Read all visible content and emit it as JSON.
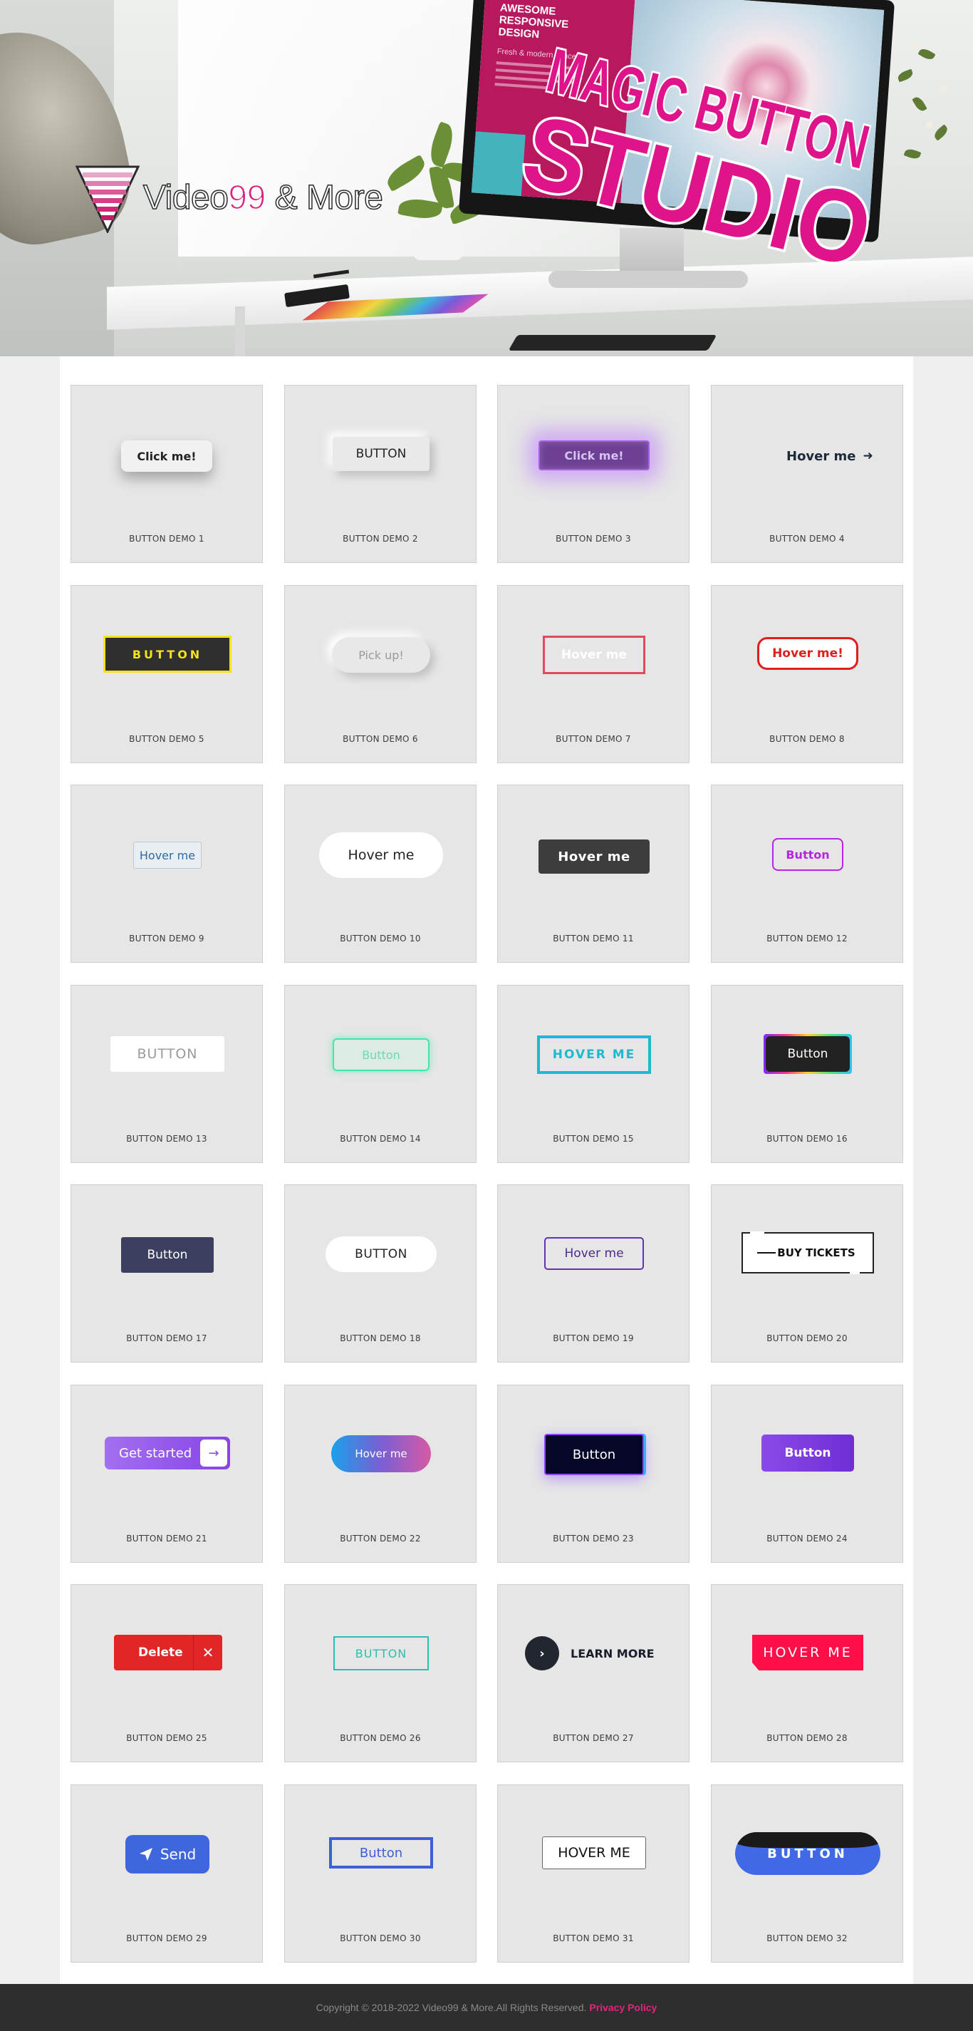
{
  "hero": {
    "logo_text_a": "Video",
    "logo_text_b": "99",
    "logo_text_c": " & More",
    "title_line1": "MAGIC BUTTON",
    "title_line2": "STUDIO",
    "screen_heading": "AWESOME RESPONSIVE DESIGN",
    "screen_sub": "Fresh & modern concept",
    "colors": {
      "brand_pink": "#d9237f"
    }
  },
  "demos": [
    {
      "button": "Click me!",
      "label": "BUTTON DEMO 1"
    },
    {
      "button": "BUTTON",
      "label": "BUTTON DEMO 2"
    },
    {
      "button": "Click me!",
      "label": "BUTTON DEMO 3"
    },
    {
      "button": "Hover me",
      "label": "BUTTON DEMO 4"
    },
    {
      "button": "BUTTON",
      "label": "BUTTON DEMO 5"
    },
    {
      "button": "Pick up!",
      "label": "BUTTON DEMO 6"
    },
    {
      "button": "Hover me",
      "label": "BUTTON DEMO 7"
    },
    {
      "button": "Hover me!",
      "label": "BUTTON DEMO 8"
    },
    {
      "button": "Hover me",
      "label": "BUTTON DEMO 9"
    },
    {
      "button": "Hover me",
      "label": "BUTTON DEMO 10"
    },
    {
      "button": "Hover me",
      "label": "BUTTON DEMO 11"
    },
    {
      "button": "Button",
      "label": "BUTTON DEMO 12"
    },
    {
      "button": "BUTTON",
      "label": "BUTTON DEMO 13"
    },
    {
      "button": "Button",
      "label": "BUTTON DEMO 14"
    },
    {
      "button": "HOVER ME",
      "label": "BUTTON DEMO 15"
    },
    {
      "button": "Button",
      "label": "BUTTON DEMO 16"
    },
    {
      "button": "Button",
      "label": "BUTTON DEMO 17"
    },
    {
      "button": "BUTTON",
      "label": "BUTTON DEMO 18"
    },
    {
      "button": "Hover me",
      "label": "BUTTON DEMO 19"
    },
    {
      "button": "BUY TICKETS",
      "label": "BUTTON DEMO 20"
    },
    {
      "button": "Get started",
      "label": "BUTTON DEMO 21"
    },
    {
      "button": "Hover me",
      "label": "BUTTON DEMO 22"
    },
    {
      "button": "Button",
      "label": "BUTTON DEMO 23"
    },
    {
      "button": "Button",
      "label": "BUTTON DEMO 24"
    },
    {
      "button": "Delete",
      "label": "BUTTON DEMO 25"
    },
    {
      "button": "BUTTON",
      "label": "BUTTON DEMO 26"
    },
    {
      "button": "LEARN MORE",
      "label": "BUTTON DEMO 27"
    },
    {
      "button": "HOVER ME",
      "label": "BUTTON DEMO 28"
    },
    {
      "button": "Send",
      "label": "BUTTON DEMO 29"
    },
    {
      "button": "Button",
      "label": "BUTTON DEMO 30"
    },
    {
      "button": "HOVER ME",
      "label": "BUTTON DEMO 31"
    },
    {
      "button": "BUTTON",
      "label": "BUTTON DEMO 32"
    }
  ],
  "icons": {
    "demo4": "arrow-right-icon",
    "demo21": "arrow-right-icon",
    "demo25": "close-icon",
    "demo27": "chevron-right-icon",
    "demo29": "paper-plane-icon"
  },
  "footer": {
    "copyright": "Copyright © 2018-2022 Video99 & More.All Rights Reserved.",
    "privacy_link": "Privacy Policy"
  }
}
